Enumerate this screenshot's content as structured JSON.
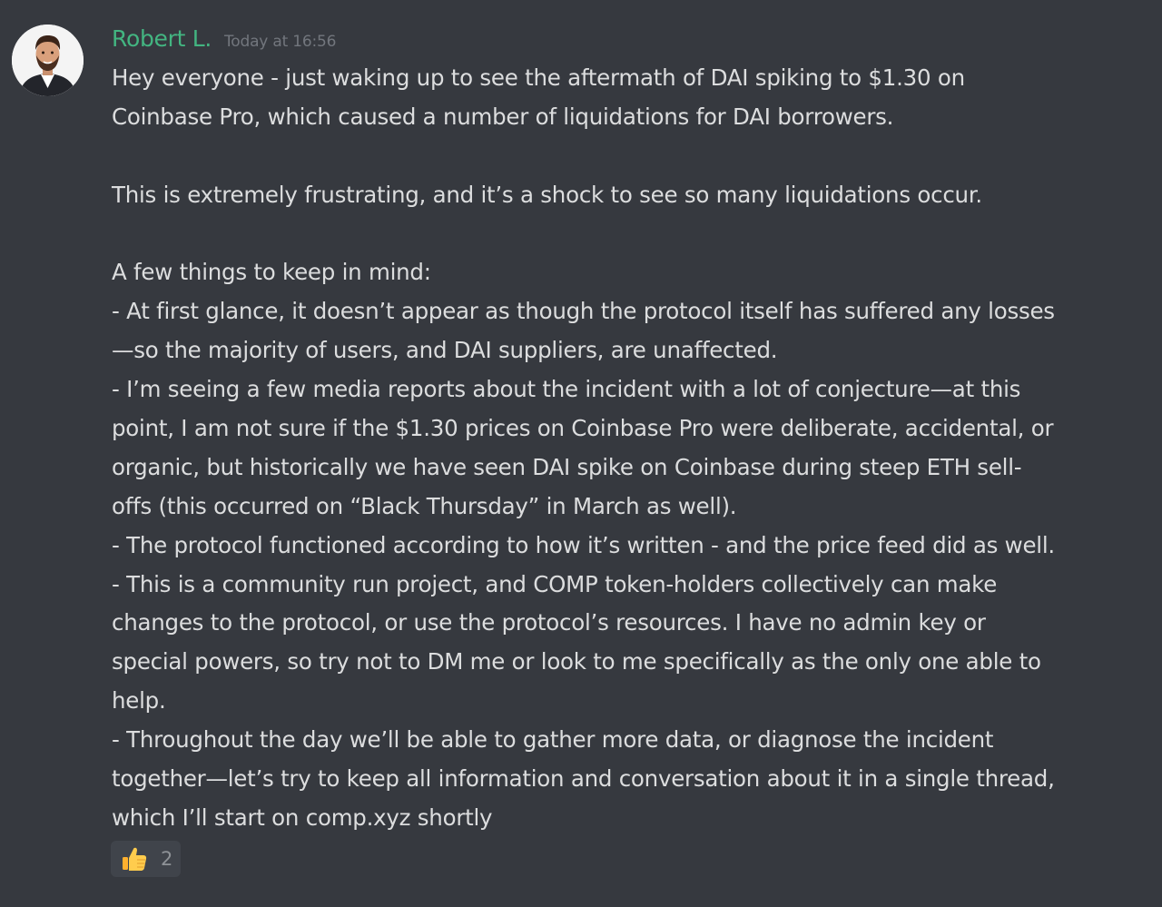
{
  "message": {
    "author": "Robert L.",
    "timestamp": "Today at 16:56",
    "author_color": "#43b581",
    "avatar_icon": "user-avatar-photo",
    "lines": [
      "Hey everyone - just waking up to see the aftermath of DAI spiking to $1.30 on",
      "Coinbase Pro, which caused a number of liquidations for DAI borrowers.",
      "",
      "This is extremely frustrating, and it’s a shock to see so many liquidations occur.",
      "",
      "A few things to keep in mind:",
      "- At first glance, it doesn’t appear as though the protocol itself has suffered any losses",
      "—so the majority of users, and DAI suppliers, are unaffected.",
      "- I’m seeing a few media reports about the incident with a lot of conjecture—at this",
      "point, I am not sure if the $1.30 prices on Coinbase Pro were deliberate, accidental, or",
      "organic, but historically we have seen DAI spike on Coinbase during steep ETH sell-",
      "offs (this occurred on “Black Thursday” in March as well).",
      "- The protocol functioned according to how it’s written - and the price feed did as well.",
      "- This is a community run project, and COMP token-holders collectively can make",
      "changes to the protocol, or use the protocol’s resources. I have no admin key or",
      "special powers, so try not to DM me or look to me specifically as the only one able to",
      "help.",
      "- Throughout the day we’ll be able to gather more data, or diagnose the incident",
      "together—let’s try to keep all information and conversation about it in a single thread,",
      "which I’ll start on comp.xyz shortly"
    ]
  },
  "reactions": [
    {
      "emoji": "thumbs-up-icon",
      "count": "2"
    }
  ],
  "colors": {
    "background": "#36393f",
    "text": "#dcddde",
    "timestamp": "#72767d",
    "reaction_bg": "#40444b"
  }
}
